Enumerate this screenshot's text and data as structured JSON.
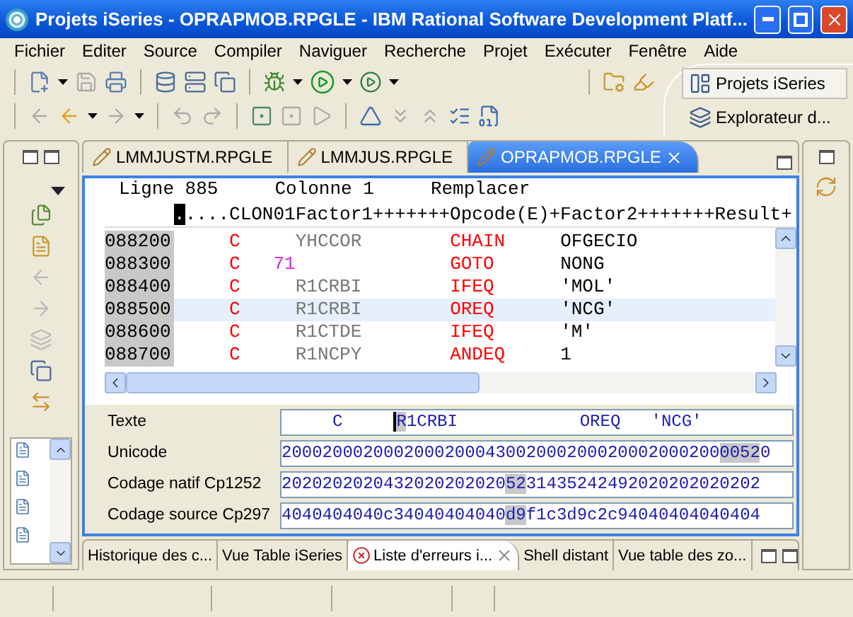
{
  "window": {
    "title": "Projets iSeries - OPRAPMOB.RPGLE - IBM Rational Software Development Platf..."
  },
  "menu": [
    "Fichier",
    "Editer",
    "Source",
    "Compiler",
    "Naviguer",
    "Recherche",
    "Projet",
    "Exécuter",
    "Fenêtre",
    "Aide"
  ],
  "perspectives": [
    {
      "label": "Projets iSeries",
      "selected": true
    },
    {
      "label": "Explorateur d...",
      "selected": false
    }
  ],
  "editor_tabs": [
    {
      "label": "LMMJUSTM.RPGLE",
      "selected": false
    },
    {
      "label": "LMMJUS.RPGLE",
      "selected": false
    },
    {
      "label": "OPRAPMOB.RPGLE",
      "selected": true
    }
  ],
  "editor": {
    "line": "Ligne 885",
    "column": "Colonne 1",
    "mode": "Remplacer",
    "ruler_cursor": ".",
    "ruler": "....CLON01Factor1+++++++Opcode(E)+Factor2+++++++Result+",
    "rows": [
      {
        "seq": "088200",
        "spec": "C",
        "indicator": "",
        "factor1": "YHCCOR",
        "opcode": "CHAIN",
        "factor2": "OFGECIO",
        "selected": false
      },
      {
        "seq": "088300",
        "spec": "C",
        "indicator": "71",
        "factor1": "",
        "opcode": "GOTO",
        "factor2": "NONG",
        "selected": false
      },
      {
        "seq": "088400",
        "spec": "C",
        "indicator": "",
        "factor1": "R1CRBI",
        "opcode": "IFEQ",
        "factor2": "'MOL'",
        "selected": false
      },
      {
        "seq": "088500",
        "spec": "C",
        "indicator": "",
        "factor1": "R1CRBI",
        "opcode": "OREQ",
        "factor2": "'NCG'",
        "selected": true
      },
      {
        "seq": "088600",
        "spec": "C",
        "indicator": "",
        "factor1": "R1CTDE",
        "opcode": "IFEQ",
        "factor2": "'M'",
        "selected": false
      },
      {
        "seq": "088700",
        "spec": "C",
        "indicator": "",
        "factor1": "R1NCPY",
        "opcode": "ANDEQ",
        "factor2": "1",
        "selected": false
      }
    ]
  },
  "fields": [
    {
      "kind": "text",
      "label": "Texte",
      "before": "     C     ",
      "highlight": "R",
      "after": "1CRBI            OREQ   'NCG'"
    },
    {
      "kind": "hex",
      "label": "Unicode",
      "before": "2000200020002000200043002000200020002000200",
      "highlight": "0052",
      "after": "0"
    },
    {
      "kind": "hex",
      "label": "Codage natif Cp1252",
      "before": "2020202020432020202020",
      "highlight": "52",
      "after": "31435242492020202020202"
    },
    {
      "kind": "hex",
      "label": "Codage source Cp297",
      "before": "4040404040c34040404040",
      "highlight": "d9",
      "after": "f1c3d9c2c94040404040404"
    }
  ],
  "bottom_tabs": [
    {
      "label": "Historique des c...",
      "selected": false
    },
    {
      "label": "Vue Table iSeries",
      "selected": false
    },
    {
      "label": "Liste d'erreurs i...",
      "selected": true
    },
    {
      "label": "Shell distant",
      "selected": false
    },
    {
      "label": "Vue table des zo...",
      "selected": false
    }
  ]
}
